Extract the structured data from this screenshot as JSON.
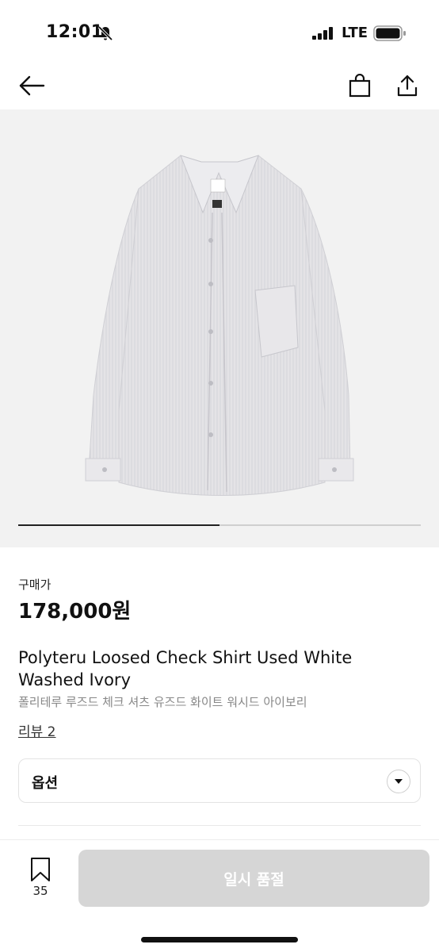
{
  "status_bar": {
    "time": "12:01",
    "network": "LTE",
    "icons": [
      "bell-slash-icon",
      "signal-icon",
      "battery-icon"
    ]
  },
  "nav": {
    "icons": [
      "arrow-left-icon",
      "shopping-bag-icon",
      "share-icon"
    ]
  },
  "gallery": {
    "progress": 0.5
  },
  "product": {
    "price_label": "구매가",
    "price": "178,000원",
    "title": "Polyteru Loosed Check Shirt Used White Washed Ivory",
    "subtitle": "폴리테루 루즈드 체크 셔츠 유즈드 화이트 워시드 아이보리",
    "review_link": "리뷰 2"
  },
  "option_select": {
    "label": "옵션",
    "icon": "chevron-down-icon"
  },
  "bottom_bar": {
    "bookmark_count": "35",
    "action_label": "일시 품절",
    "action_color": "#d6d6d6"
  }
}
